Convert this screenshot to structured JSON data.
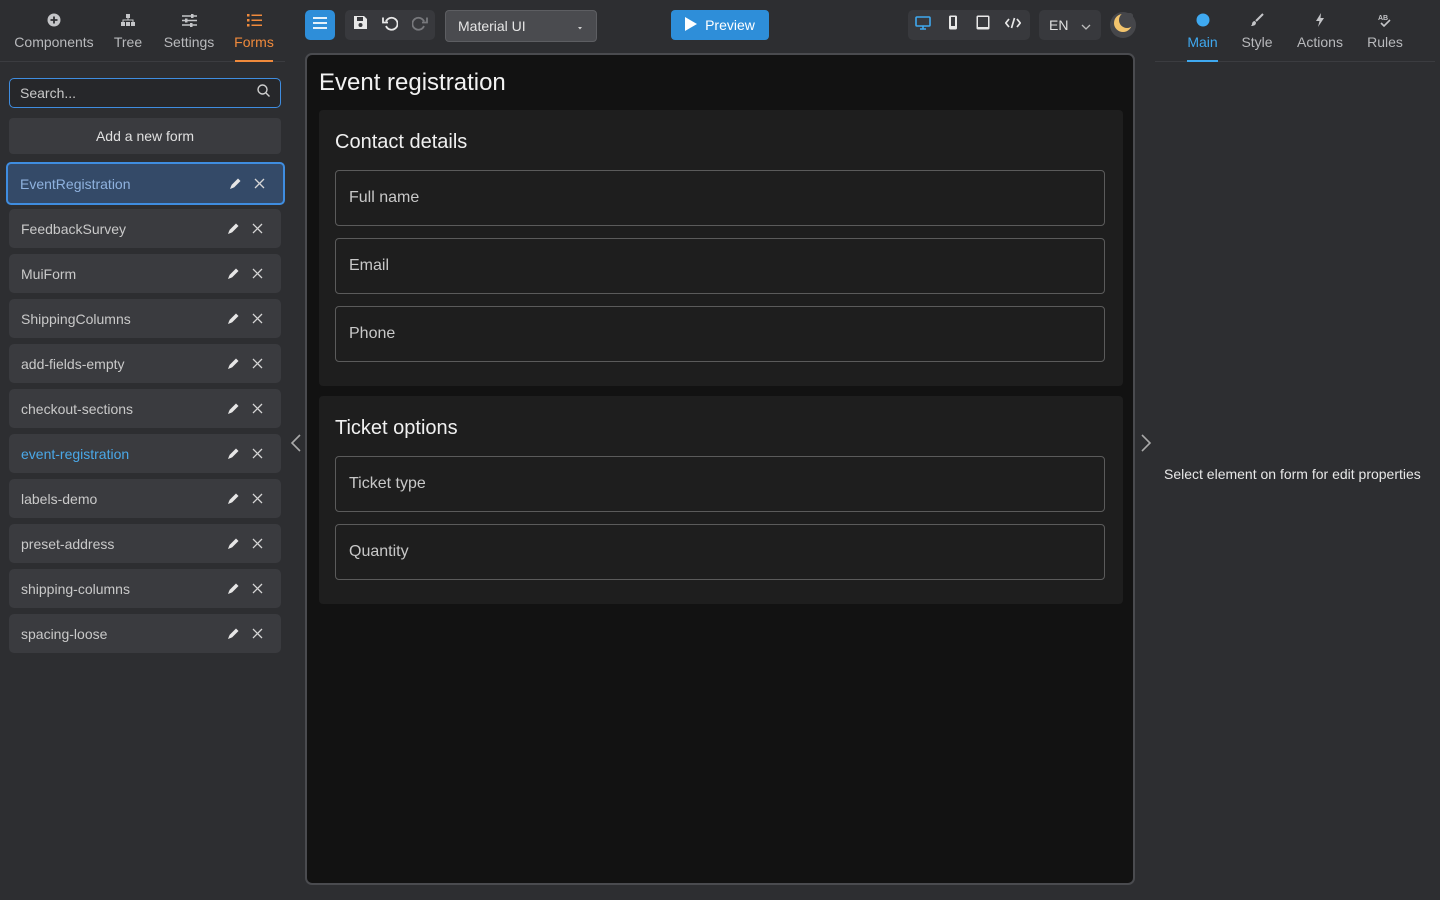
{
  "left_tabs": [
    {
      "label": "Components",
      "icon": "plus-circle-icon"
    },
    {
      "label": "Tree",
      "icon": "tree-icon"
    },
    {
      "label": "Settings",
      "icon": "sliders-icon"
    },
    {
      "label": "Forms",
      "icon": "list-icon",
      "active": true
    }
  ],
  "search": {
    "placeholder": "Search..."
  },
  "add_form_label": "Add a new form",
  "forms": [
    "EventRegistration",
    "FeedbackSurvey",
    "MuiForm",
    "ShippingColumns",
    "add-fields-empty",
    "checkout-sections",
    "event-registration",
    "labels-demo",
    "preset-address",
    "shipping-columns",
    "spacing-loose"
  ],
  "selected_form": "EventRegistration",
  "current_form": "event-registration",
  "toolbar": {
    "framework": "Material UI",
    "preview_label": "Preview",
    "language": "EN"
  },
  "canvas": {
    "form_title": "Event registration",
    "sections": [
      {
        "title": "Contact details",
        "fields": [
          "Full name",
          "Email",
          "Phone"
        ]
      },
      {
        "title": "Ticket options",
        "fields": [
          "Ticket type",
          "Quantity"
        ]
      }
    ]
  },
  "right_tabs": [
    {
      "label": "Main",
      "icon": "dot-icon",
      "active": true
    },
    {
      "label": "Style",
      "icon": "brush-icon"
    },
    {
      "label": "Actions",
      "icon": "bolt-icon"
    },
    {
      "label": "Rules",
      "icon": "rules-icon"
    }
  ],
  "right_hint": "Select element on form for edit properties",
  "colors": {
    "accent_blue": "#2e8ed9",
    "accent_orange": "#f08a3c",
    "background": "#2d2e31",
    "canvas": "#121212"
  }
}
